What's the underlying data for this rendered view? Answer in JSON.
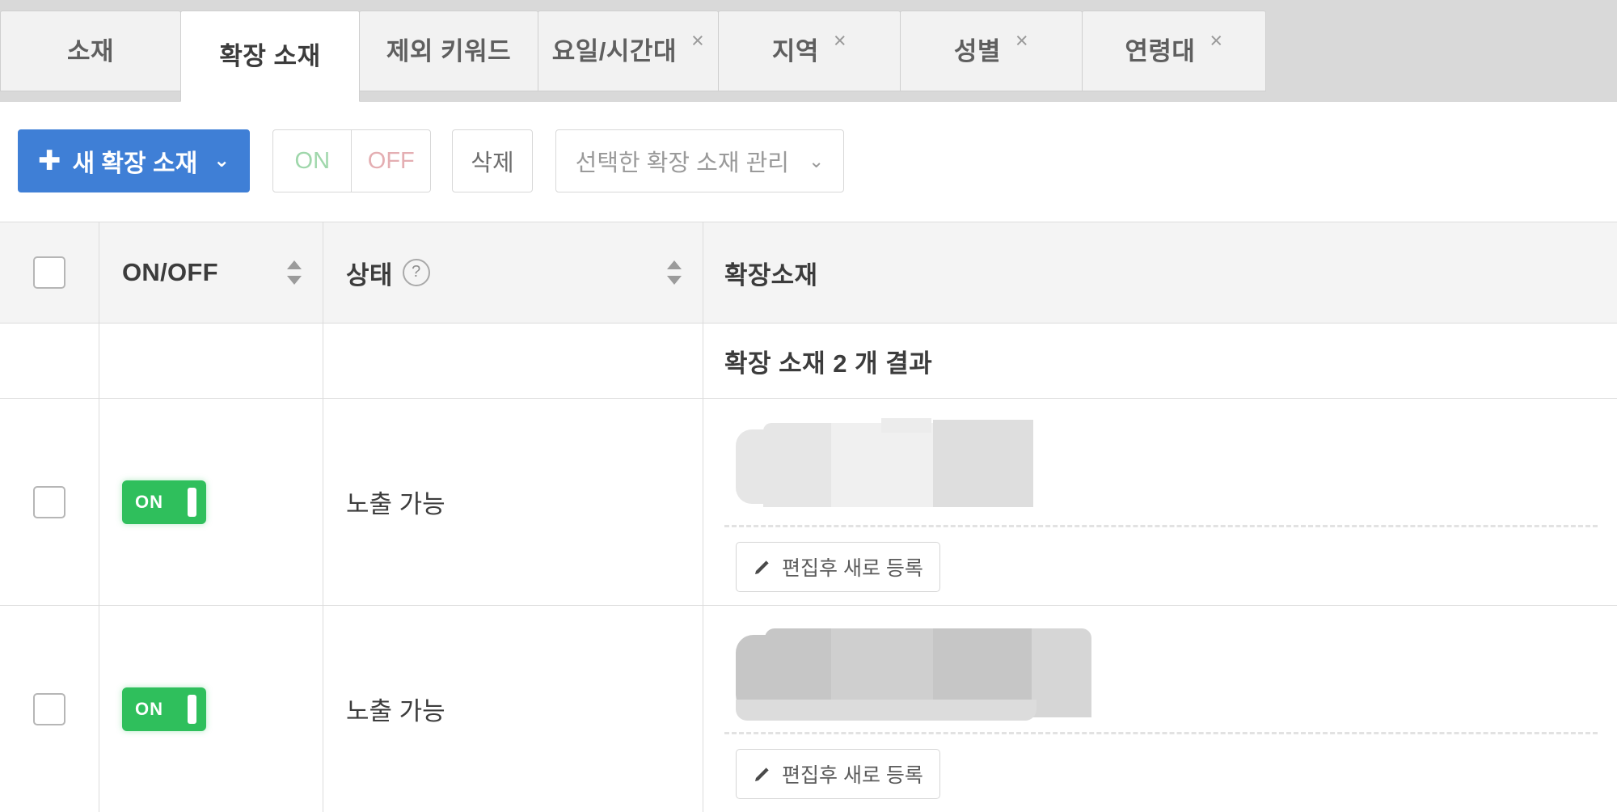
{
  "colors": {
    "primary_button": "#3f7fd6",
    "toggle_on": "#2fbf5c",
    "on_text": "#9fd7ab",
    "off_text": "#e4aeb2",
    "tabstrip_bg": "#d9d9d9",
    "header_bg": "#f4f4f4",
    "border": "#dcdcdc"
  },
  "tabs": [
    {
      "label": "소재",
      "active": false,
      "closable": false
    },
    {
      "label": "확장 소재",
      "active": true,
      "closable": false
    },
    {
      "label": "제외 키워드",
      "active": false,
      "closable": false
    },
    {
      "label": "요일/시간대",
      "active": false,
      "closable": true,
      "close_glyph": "×"
    },
    {
      "label": "지역",
      "active": false,
      "closable": true,
      "close_glyph": "×"
    },
    {
      "label": "성별",
      "active": false,
      "closable": true,
      "close_glyph": "×"
    },
    {
      "label": "연령대",
      "active": false,
      "closable": true,
      "close_glyph": "×"
    }
  ],
  "toolbar": {
    "new_button": {
      "plus": "✚",
      "label": "새 확장 소재",
      "caret": "⌄"
    },
    "on_button": "ON",
    "off_button": "OFF",
    "delete_button": "삭제",
    "manage_select": {
      "label": "선택한 확장 소재 관리",
      "caret": "⌄"
    }
  },
  "table": {
    "headers": {
      "select_all": "",
      "onoff": "ON/OFF",
      "state": "상태",
      "state_help_glyph": "?",
      "material": "확장소재"
    },
    "summary": "확장 소재 2 개 결과",
    "rows": [
      {
        "checked": false,
        "toggle_label": "ON",
        "state": "노출 가능",
        "material_redacted": true,
        "edit_button": "편집후 새로 등록"
      },
      {
        "checked": false,
        "toggle_label": "ON",
        "state": "노출 가능",
        "material_redacted": true,
        "edit_button": "편집후 새로 등록"
      }
    ]
  }
}
